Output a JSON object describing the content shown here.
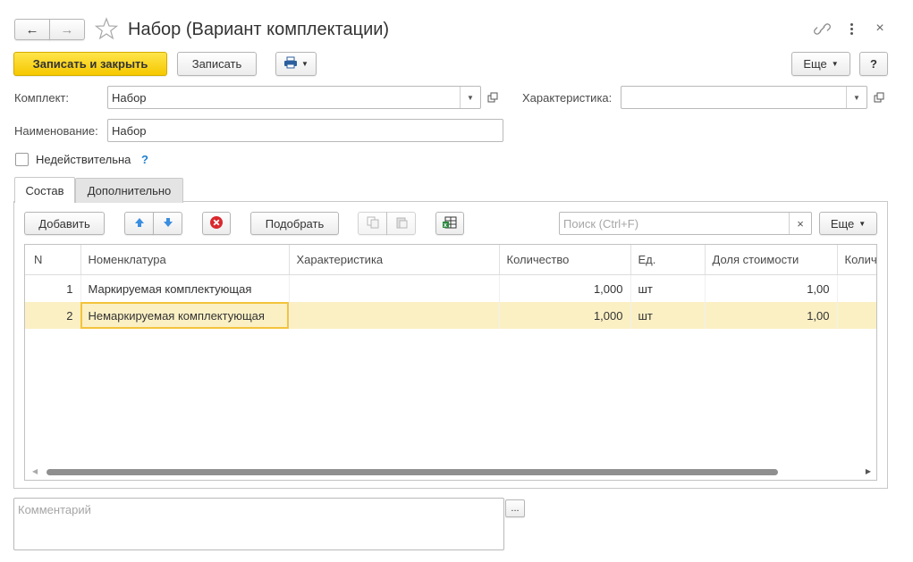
{
  "window": {
    "title": "Набор (Вариант комплектации)"
  },
  "toolbar": {
    "save_close_label": "Записать и закрыть",
    "save_label": "Записать",
    "more_label": "Еще",
    "help_label": "?"
  },
  "form": {
    "komplekt_label": "Комплект:",
    "komplekt_value": "Набор",
    "characteristic_label": "Характеристика:",
    "characteristic_value": "",
    "name_label": "Наименование:",
    "name_value": "Набор",
    "invalid_label": "Недействительна",
    "invalid_help": "?"
  },
  "tabs": [
    {
      "label": "Состав",
      "active": true
    },
    {
      "label": "Дополнительно",
      "active": false
    }
  ],
  "table_toolbar": {
    "add_label": "Добавить",
    "select_label": "Подобрать",
    "search_placeholder": "Поиск (Ctrl+F)",
    "clear_label": "×",
    "more_label": "Еще"
  },
  "table": {
    "columns": [
      "N",
      "Номенклатура",
      "Характеристика",
      "Количество",
      "Ед.",
      "Доля стоимости",
      "Колич"
    ],
    "rows": [
      {
        "n": "1",
        "item": "Маркируемая комплектующая",
        "characteristic": "",
        "qty": "1,000",
        "unit": "шт",
        "share": "1,00",
        "selected": false
      },
      {
        "n": "2",
        "item": "Немаркируемая комплектующая",
        "characteristic": "",
        "qty": "1,000",
        "unit": "шт",
        "share": "1,00",
        "selected": true
      }
    ]
  },
  "comment": {
    "placeholder": "Комментарий",
    "button_label": "..."
  },
  "colors": {
    "primary": "#f5c800",
    "selection_row": "#fbf0c4",
    "current_cell_border": "#f3c43b",
    "link_help": "#1e7fd1",
    "delete_red": "#d9282f"
  }
}
